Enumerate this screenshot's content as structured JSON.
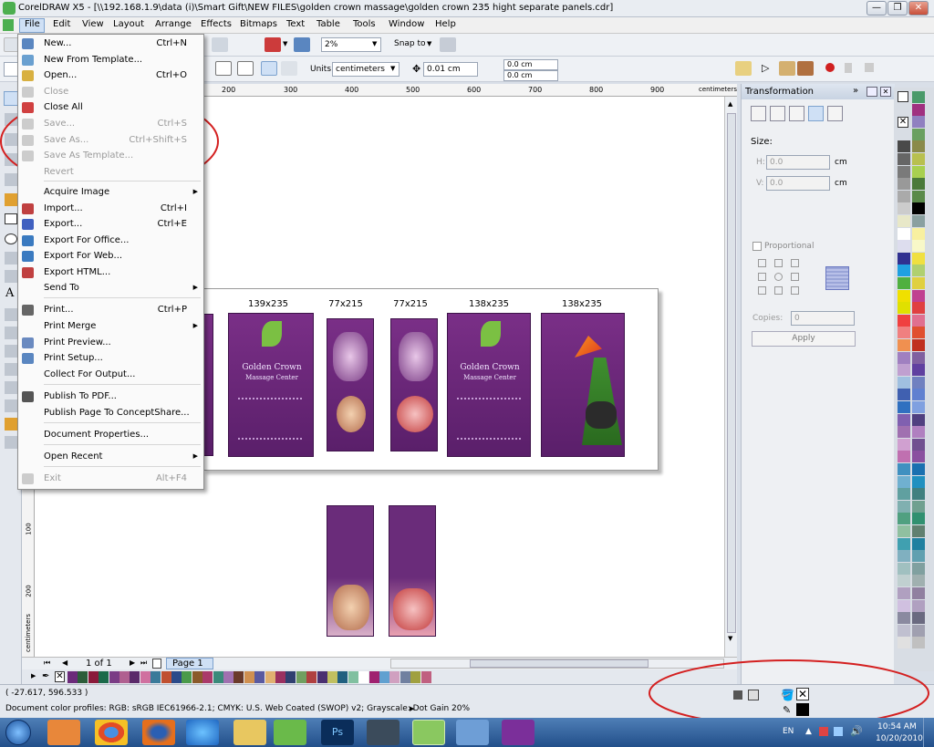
{
  "window": {
    "title": "CorelDRAW X5 - [\\\\192.168.1.9\\data (i)\\Smart Gift\\NEW FILES\\golden crown massage\\golden crown 235 hight separate panels.cdr]",
    "minimize": "—",
    "maximize": "❐",
    "close": "✕"
  },
  "menubar": [
    "File",
    "Edit",
    "View",
    "Layout",
    "Arrange",
    "Effects",
    "Bitmaps",
    "Text",
    "Table",
    "Tools",
    "Window",
    "Help"
  ],
  "toolbar1": {
    "zoom": "2%",
    "snap_to": "Snap to"
  },
  "toolbar2": {
    "units_label": "Units:",
    "units_value": "centimeters",
    "nudge": "0.01 cm",
    "dup_x": "0.0 cm",
    "dup_y": "0.0 cm"
  },
  "ruler": {
    "top_ticks": [
      "200",
      "300",
      "400",
      "500",
      "600",
      "700",
      "800",
      "900"
    ],
    "unit": "centimeters",
    "left_ticks": [
      "100",
      "200"
    ],
    "left_unit": "centimeters"
  },
  "file_menu": [
    {
      "label": "New...",
      "shortcut": "Ctrl+N",
      "enabled": true
    },
    {
      "label": "New From Template...",
      "shortcut": "",
      "enabled": true
    },
    {
      "label": "Open...",
      "shortcut": "Ctrl+O",
      "enabled": true
    },
    {
      "label": "Close",
      "shortcut": "",
      "enabled": false
    },
    {
      "label": "Close All",
      "shortcut": "",
      "enabled": true
    },
    {
      "label": "Save...",
      "shortcut": "Ctrl+S",
      "enabled": false
    },
    {
      "label": "Save As...",
      "shortcut": "Ctrl+Shift+S",
      "enabled": false
    },
    {
      "label": "Save As Template...",
      "shortcut": "",
      "enabled": false
    },
    {
      "label": "Revert",
      "shortcut": "",
      "enabled": false
    },
    {
      "label": "Acquire Image",
      "shortcut": "",
      "enabled": true,
      "submenu": true
    },
    {
      "label": "Import...",
      "shortcut": "Ctrl+I",
      "enabled": true
    },
    {
      "label": "Export...",
      "shortcut": "Ctrl+E",
      "enabled": true
    },
    {
      "label": "Export For Office...",
      "shortcut": "",
      "enabled": true
    },
    {
      "label": "Export For Web...",
      "shortcut": "",
      "enabled": true
    },
    {
      "label": "Export HTML...",
      "shortcut": "",
      "enabled": true
    },
    {
      "label": "Send To",
      "shortcut": "",
      "enabled": true,
      "submenu": true
    },
    {
      "label": "Print...",
      "shortcut": "Ctrl+P",
      "enabled": true
    },
    {
      "label": "Print Merge",
      "shortcut": "",
      "enabled": true,
      "submenu": true
    },
    {
      "label": "Print Preview...",
      "shortcut": "",
      "enabled": true
    },
    {
      "label": "Print Setup...",
      "shortcut": "",
      "enabled": true
    },
    {
      "label": "Collect For Output...",
      "shortcut": "",
      "enabled": true
    },
    {
      "label": "Publish To PDF...",
      "shortcut": "",
      "enabled": true
    },
    {
      "label": "Publish Page To ConceptShare...",
      "shortcut": "",
      "enabled": true
    },
    {
      "label": "Document Properties...",
      "shortcut": "",
      "enabled": true
    },
    {
      "label": "Open Recent",
      "shortcut": "",
      "enabled": true,
      "submenu": true
    },
    {
      "label": "Exit",
      "shortcut": "Alt+F4",
      "enabled": false
    }
  ],
  "canvas": {
    "labels": [
      "139x235",
      "77x215",
      "77x215",
      "138x235",
      "138x235"
    ],
    "brand_title": "Golden Crown",
    "brand_subtitle": "Massage Center"
  },
  "pagebar": {
    "page_counter": "1 of 1",
    "page_tab": "Page 1"
  },
  "docker": {
    "title": "Transformation",
    "size_label": "Size:",
    "h_label": "H:",
    "h_value": "0.0",
    "h_unit": "cm",
    "v_label": "V:",
    "v_value": "0.0",
    "v_unit": "cm",
    "proportional": "Proportional",
    "copies_label": "Copies:",
    "copies_value": "0",
    "apply": "Apply"
  },
  "statusbar": {
    "coords": "( -27.617, 596.533 )",
    "color_profiles": "Document color profiles: RGB: sRGB IEC61966-2.1; CMYK: U.S. Web Coated (SWOP) v2; Grayscale: Dot Gain 20%"
  },
  "taskbar": {
    "lang": "EN",
    "time": "10:54 AM",
    "date": "10/20/2010"
  },
  "colors": {
    "accent_purple": "#6b2a7a",
    "annotation_red": "#d42020",
    "menu_bg": "#fafafa"
  }
}
